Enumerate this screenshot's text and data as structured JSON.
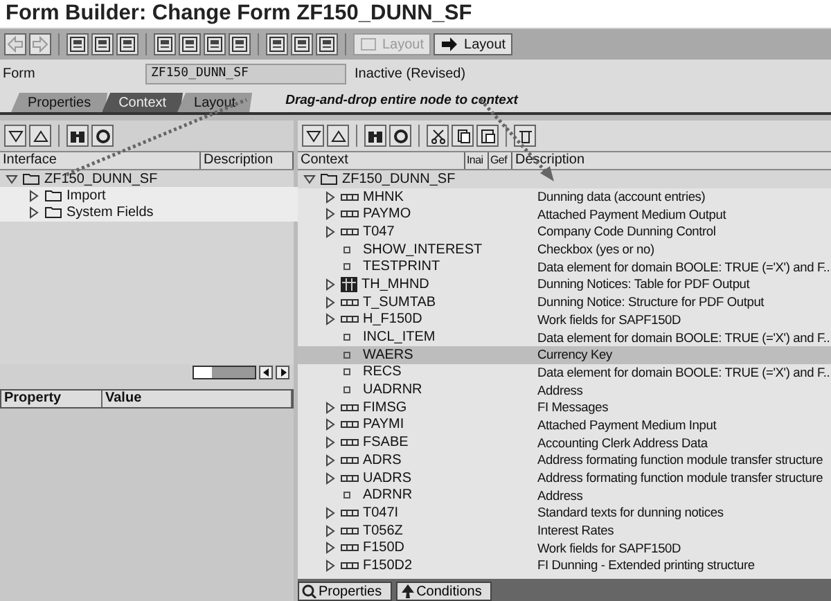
{
  "window": {
    "title": "Form Builder: Change Form ZF150_DUNN_SF"
  },
  "toolbar": {
    "buttons": [
      {
        "label": "Layout",
        "disabled": true
      },
      {
        "label": "Layout",
        "disabled": false
      }
    ]
  },
  "form": {
    "label": "Form",
    "value": "ZF150_DUNN_SF",
    "status": "Inactive (Revised)"
  },
  "tabs": [
    {
      "label": "Properties",
      "selected": false
    },
    {
      "label": "Context",
      "selected": true
    },
    {
      "label": "Layout",
      "selected": false
    }
  ],
  "hint": "Drag-and-drop entire node to context",
  "interface": {
    "columns": [
      "Interface",
      "Description"
    ],
    "tree": [
      {
        "name": "ZF150_DUNN_SF",
        "expanded": true,
        "children": [
          {
            "name": "Import",
            "expanded": false
          },
          {
            "name": "System Fields",
            "expanded": false
          }
        ]
      }
    ]
  },
  "properties": {
    "columns": [
      "Property",
      "Value"
    ]
  },
  "context": {
    "columns": [
      "Context",
      "Inai",
      "Gef",
      "Description"
    ],
    "tree": [
      {
        "name": "ZF150_DUNN_SF",
        "expanded": true,
        "children": [
          {
            "name": "MHNK",
            "kind": "structure",
            "description": "Dunning data (account entries)",
            "selected": false
          },
          {
            "name": "PAYMO",
            "kind": "structure",
            "description": "Attached Payment Medium Output",
            "selected": false
          },
          {
            "name": "T047",
            "kind": "structure",
            "description": "Company Code Dunning Control",
            "selected": false
          },
          {
            "name": "SHOW_INTEREST",
            "kind": "field",
            "description": "Checkbox (yes or no)",
            "selected": false
          },
          {
            "name": "TESTPRINT",
            "kind": "field",
            "description": "Data element for domain BOOLE: TRUE (='X') and F...",
            "selected": false
          },
          {
            "name": "TH_MHND",
            "kind": "table",
            "description": "Dunning Notices: Table for PDF Output",
            "selected": false
          },
          {
            "name": "T_SUMTAB",
            "kind": "structure",
            "description": "Dunning Notice: Structure for PDF Output",
            "selected": false
          },
          {
            "name": "H_F150D",
            "kind": "structure",
            "description": "Work fields for SAPF150D",
            "selected": false
          },
          {
            "name": "INCL_ITEM",
            "kind": "field",
            "description": "Data element for domain BOOLE: TRUE (='X') and F...",
            "selected": false
          },
          {
            "name": "WAERS",
            "kind": "field",
            "description": "Currency Key",
            "selected": true
          },
          {
            "name": "RECS",
            "kind": "field",
            "description": "Data element for domain BOOLE: TRUE (='X') and F...",
            "selected": false
          },
          {
            "name": "UADRNR",
            "kind": "field",
            "description": "Address",
            "selected": false
          },
          {
            "name": "FIMSG",
            "kind": "structure",
            "description": "FI Messages",
            "selected": false
          },
          {
            "name": "PAYMI",
            "kind": "structure",
            "description": "Attached Payment Medium Input",
            "selected": false
          },
          {
            "name": "FSABE",
            "kind": "structure",
            "description": "Accounting Clerk Address Data",
            "selected": false
          },
          {
            "name": "ADRS",
            "kind": "structure",
            "description": "Address formating function module transfer structure",
            "selected": false
          },
          {
            "name": "UADRS",
            "kind": "structure",
            "description": "Address formating function module transfer structure",
            "selected": false
          },
          {
            "name": "ADRNR",
            "kind": "field",
            "description": "Address",
            "selected": false
          },
          {
            "name": "T047I",
            "kind": "structure",
            "description": "Standard texts for dunning notices",
            "selected": false
          },
          {
            "name": "T056Z",
            "kind": "structure",
            "description": "Interest Rates",
            "selected": false
          },
          {
            "name": "F150D",
            "kind": "structure",
            "description": "Work fields for SAPF150D",
            "selected": false
          },
          {
            "name": "F150D2",
            "kind": "structure",
            "description": "FI Dunning - Extended printing structure",
            "selected": false
          }
        ]
      }
    ]
  },
  "bottom_tabs": [
    {
      "label": "Properties"
    },
    {
      "label": "Conditions"
    }
  ]
}
